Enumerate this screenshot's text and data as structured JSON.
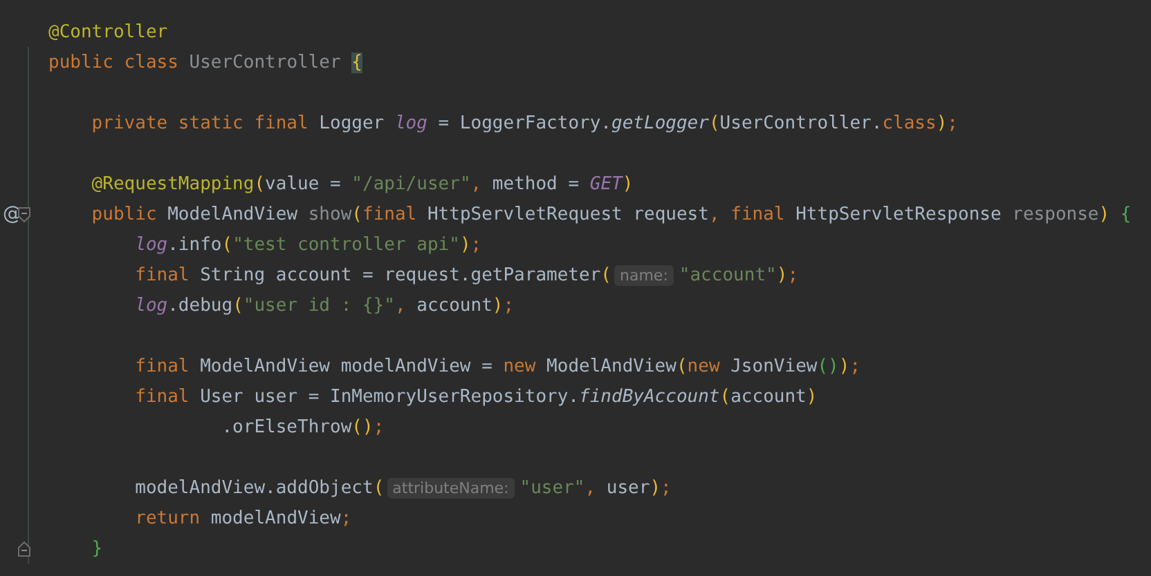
{
  "editor": {
    "lines": [
      {
        "kind": "code",
        "tokens": [
          {
            "kind": "annotation",
            "text": "@Controller"
          }
        ]
      },
      {
        "kind": "code",
        "tokens": [
          {
            "kind": "keyword",
            "text": "public class "
          },
          {
            "kind": "unused",
            "text": "UserController "
          },
          {
            "kind": "matched-brace",
            "text": "{"
          }
        ]
      },
      {
        "kind": "blank"
      },
      {
        "kind": "code",
        "tokens": [
          {
            "kind": "keyword",
            "text": "    private static final"
          },
          {
            "kind": "plain",
            "text": " Logger "
          },
          {
            "kind": "field",
            "text": "log"
          },
          {
            "kind": "plain",
            "text": " = LoggerFactory."
          },
          {
            "kind": "static",
            "text": "getLogger"
          },
          {
            "kind": "bracket",
            "color": "#e8ba36",
            "text": "("
          },
          {
            "kind": "plain",
            "text": "UserController."
          },
          {
            "kind": "keyword",
            "text": "class"
          },
          {
            "kind": "bracket",
            "color": "#e8ba36",
            "text": ")"
          },
          {
            "kind": "keyword",
            "text": ";"
          }
        ]
      },
      {
        "kind": "blank"
      },
      {
        "kind": "code",
        "tokens": [
          {
            "kind": "annotation",
            "text": "    @RequestMapping"
          },
          {
            "kind": "bracket",
            "color": "#e8ba36",
            "text": "("
          },
          {
            "kind": "plain",
            "text": "value = "
          },
          {
            "kind": "string",
            "text": "\"/api/user\""
          },
          {
            "kind": "keyword",
            "text": ", "
          },
          {
            "kind": "plain",
            "text": "method = "
          },
          {
            "kind": "field",
            "text": "GET"
          },
          {
            "kind": "bracket",
            "color": "#e8ba36",
            "text": ")"
          }
        ]
      },
      {
        "kind": "code",
        "marker": "@",
        "fold_marker": {
          "kind": "start"
        },
        "tokens": [
          {
            "kind": "keyword",
            "text": "    public"
          },
          {
            "kind": "plain",
            "text": " ModelAndView "
          },
          {
            "kind": "unused",
            "text": "show"
          },
          {
            "kind": "bracket",
            "color": "#e8ba36",
            "text": "("
          },
          {
            "kind": "keyword",
            "text": "final"
          },
          {
            "kind": "plain",
            "text": " HttpServletRequest request"
          },
          {
            "kind": "keyword",
            "text": ", final"
          },
          {
            "kind": "plain",
            "text": " HttpServletResponse "
          },
          {
            "kind": "unused",
            "text": "response"
          },
          {
            "kind": "bracket",
            "color": "#e8ba36",
            "text": ")"
          },
          {
            "kind": "bracket",
            "color": "#54a857",
            "text": " {"
          }
        ]
      },
      {
        "kind": "code",
        "tokens": [
          {
            "kind": "field",
            "text": "        log"
          },
          {
            "kind": "plain",
            "text": ".info"
          },
          {
            "kind": "bracket",
            "color": "#e8ba36",
            "text": "("
          },
          {
            "kind": "string",
            "text": "\"test controller api\""
          },
          {
            "kind": "bracket",
            "color": "#e8ba36",
            "text": ")"
          },
          {
            "kind": "keyword",
            "text": ";"
          }
        ]
      },
      {
        "kind": "code",
        "tokens": [
          {
            "kind": "keyword",
            "text": "        final"
          },
          {
            "kind": "plain",
            "text": " String account = request.getParameter"
          },
          {
            "kind": "bracket",
            "color": "#e8ba36",
            "text": "("
          },
          {
            "kind": "hint",
            "text": "name:"
          },
          {
            "kind": "string",
            "text": "\"account\""
          },
          {
            "kind": "bracket",
            "color": "#e8ba36",
            "text": ")"
          },
          {
            "kind": "keyword",
            "text": ";"
          }
        ]
      },
      {
        "kind": "code",
        "tokens": [
          {
            "kind": "field",
            "text": "        log"
          },
          {
            "kind": "plain",
            "text": ".debug"
          },
          {
            "kind": "bracket",
            "color": "#e8ba36",
            "text": "("
          },
          {
            "kind": "string",
            "text": "\"user id : {}\""
          },
          {
            "kind": "keyword",
            "text": ", "
          },
          {
            "kind": "plain",
            "text": "account"
          },
          {
            "kind": "bracket",
            "color": "#e8ba36",
            "text": ")"
          },
          {
            "kind": "keyword",
            "text": ";"
          }
        ]
      },
      {
        "kind": "blank"
      },
      {
        "kind": "code",
        "tokens": [
          {
            "kind": "keyword",
            "text": "        final"
          },
          {
            "kind": "plain",
            "text": " ModelAndView modelAndView = "
          },
          {
            "kind": "keyword",
            "text": "new"
          },
          {
            "kind": "plain",
            "text": " ModelAndView"
          },
          {
            "kind": "bracket",
            "color": "#e8ba36",
            "text": "("
          },
          {
            "kind": "keyword",
            "text": "new"
          },
          {
            "kind": "plain",
            "text": " JsonView"
          },
          {
            "kind": "bracket",
            "color": "#54a857",
            "text": "()"
          },
          {
            "kind": "bracket",
            "color": "#e8ba36",
            "text": ")"
          },
          {
            "kind": "keyword",
            "text": ";"
          }
        ]
      },
      {
        "kind": "code",
        "tokens": [
          {
            "kind": "keyword",
            "text": "        final"
          },
          {
            "kind": "plain",
            "text": " User user = InMemoryUserRepository."
          },
          {
            "kind": "static",
            "text": "findByAccount"
          },
          {
            "kind": "bracket",
            "color": "#e8ba36",
            "text": "("
          },
          {
            "kind": "plain",
            "text": "account"
          },
          {
            "kind": "bracket",
            "color": "#e8ba36",
            "text": ")"
          }
        ]
      },
      {
        "kind": "code",
        "tokens": [
          {
            "kind": "plain",
            "text": "                .orElseThrow"
          },
          {
            "kind": "bracket",
            "color": "#e8ba36",
            "text": "()"
          },
          {
            "kind": "keyword",
            "text": ";"
          }
        ]
      },
      {
        "kind": "blank"
      },
      {
        "kind": "code",
        "tokens": [
          {
            "kind": "plain",
            "text": "        modelAndView.addObject"
          },
          {
            "kind": "bracket",
            "color": "#e8ba36",
            "text": "("
          },
          {
            "kind": "hint",
            "text": "attributeName:"
          },
          {
            "kind": "string",
            "text": "\"user\""
          },
          {
            "kind": "keyword",
            "text": ", "
          },
          {
            "kind": "plain",
            "text": "user"
          },
          {
            "kind": "bracket",
            "color": "#e8ba36",
            "text": ")"
          },
          {
            "kind": "keyword",
            "text": ";"
          }
        ]
      },
      {
        "kind": "code",
        "tokens": [
          {
            "kind": "keyword",
            "text": "        return"
          },
          {
            "kind": "plain",
            "text": " modelAndView"
          },
          {
            "kind": "keyword",
            "text": ";"
          }
        ]
      },
      {
        "kind": "code",
        "fold_marker": {
          "kind": "end"
        },
        "tokens": [
          {
            "kind": "bracket",
            "color": "#54a857",
            "text": "    }"
          }
        ]
      }
    ]
  }
}
